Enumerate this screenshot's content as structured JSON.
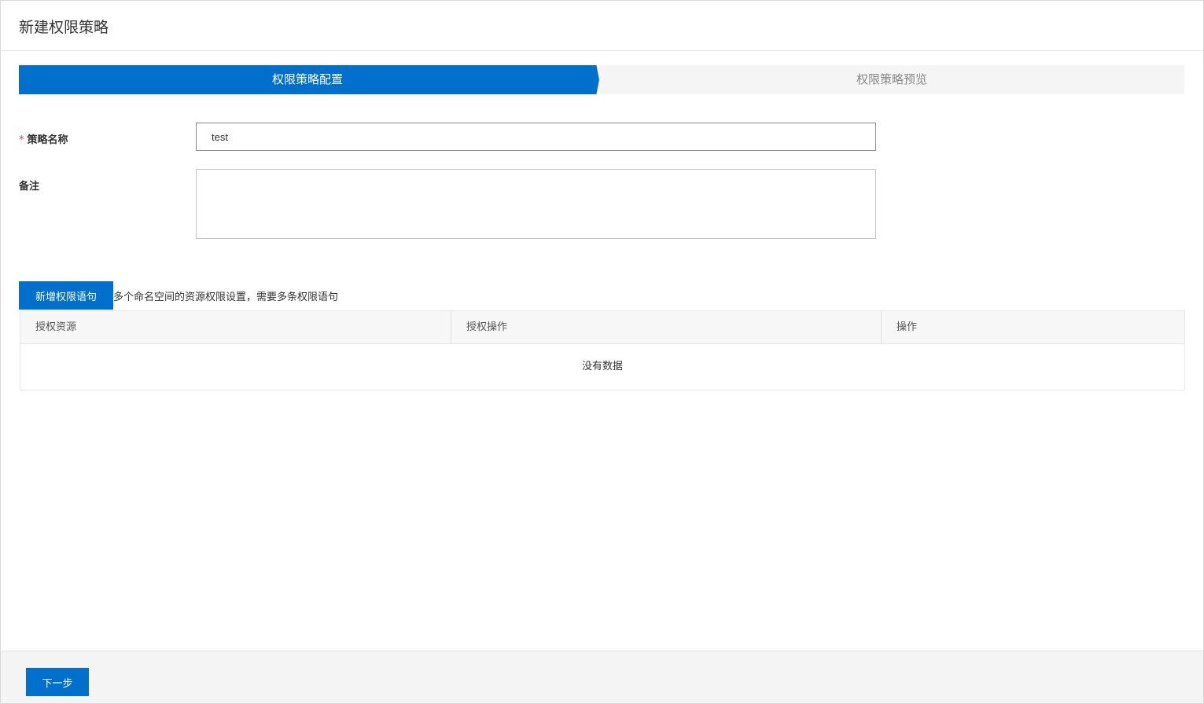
{
  "header": {
    "title": "新建权限策略"
  },
  "steps": [
    {
      "label": "权限策略配置",
      "active": true
    },
    {
      "label": "权限策略预览",
      "active": false
    }
  ],
  "form": {
    "name": {
      "required_mark": "*",
      "label": "策略名称",
      "value": "test"
    },
    "note": {
      "label": "备注",
      "value": ""
    }
  },
  "statements": {
    "add_button": "新增权限语句",
    "hint": "多个命名空间的资源权限设置，需要多条权限语句",
    "columns": [
      "授权资源",
      "授权操作",
      "操作"
    ],
    "empty_text": "没有数据"
  },
  "footer": {
    "next_button": "下一步"
  },
  "colors": {
    "primary": "#0070cc",
    "required": "#e4393c"
  }
}
